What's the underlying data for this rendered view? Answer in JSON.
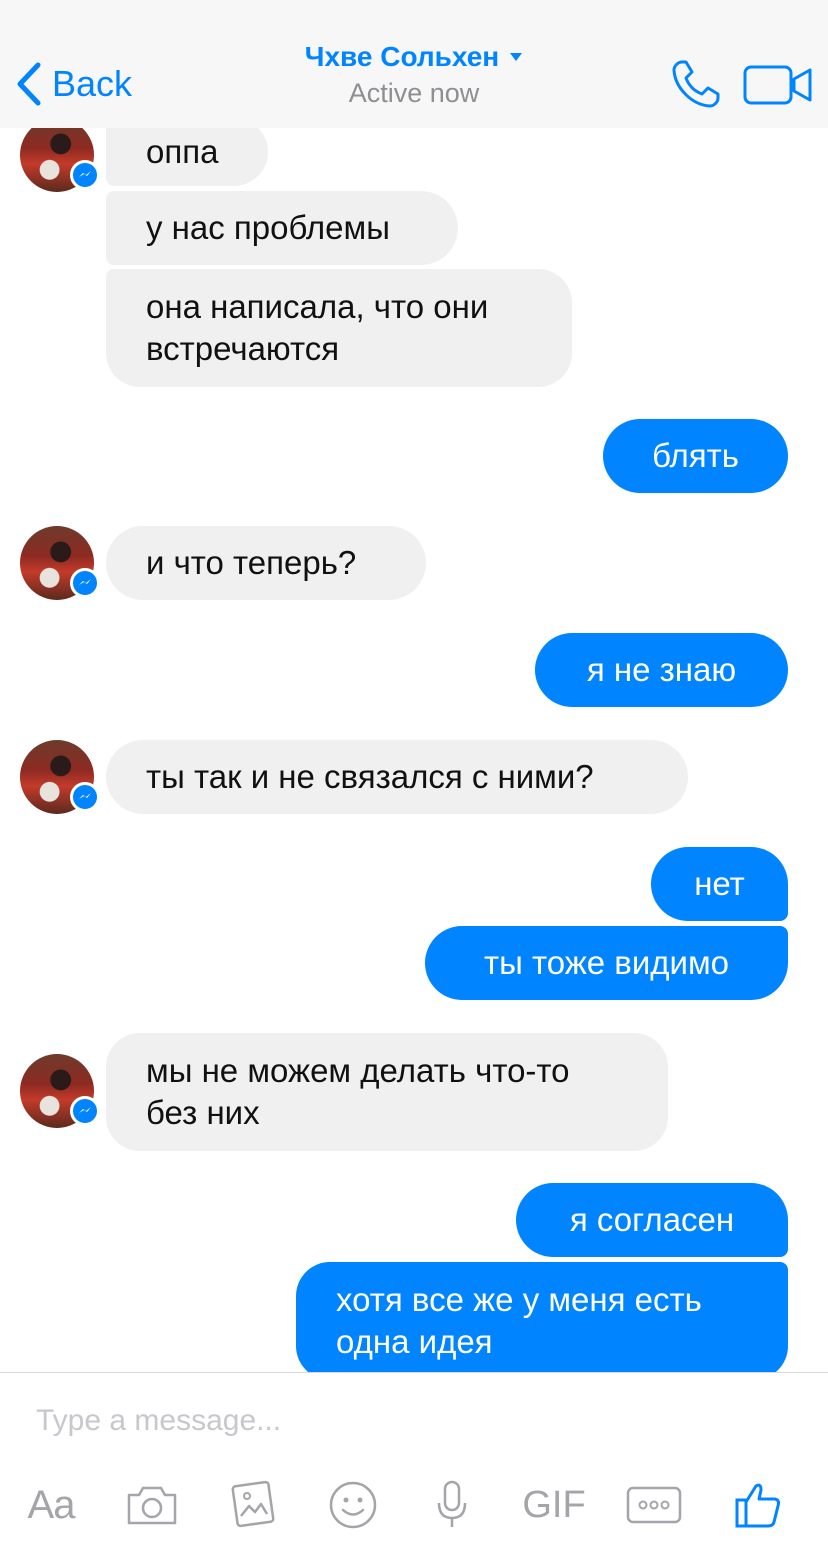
{
  "header": {
    "back_label": "Back",
    "contact_name": "Чхве Сольхен",
    "status": "Active now"
  },
  "messages": [
    {
      "direction": "incoming",
      "text": "оппа"
    },
    {
      "direction": "incoming",
      "text": "у нас проблемы"
    },
    {
      "direction": "incoming",
      "text": "она написала, что они\nвстречаются"
    },
    {
      "direction": "outgoing",
      "text": "блять"
    },
    {
      "direction": "incoming",
      "text": "и что теперь?"
    },
    {
      "direction": "outgoing",
      "text": "я не знаю"
    },
    {
      "direction": "incoming",
      "text": "ты так и не связался с ними?"
    },
    {
      "direction": "outgoing",
      "text": "нет"
    },
    {
      "direction": "outgoing",
      "text": "ты тоже видимо"
    },
    {
      "direction": "incoming",
      "text": "мы не можем делать что-то\nбез них"
    },
    {
      "direction": "outgoing",
      "text": "я согласен"
    },
    {
      "direction": "outgoing",
      "text": "хотя все же у меня есть\nодна идея"
    }
  ],
  "composer": {
    "placeholder": "Type a message...",
    "aa_label": "Aa",
    "gif_label": "GIF",
    "tools": [
      "text-format-icon",
      "camera-icon",
      "photo-icon",
      "emoji-icon",
      "microphone-icon",
      "gif-icon",
      "more-icon",
      "like-icon"
    ]
  },
  "colors": {
    "accent": "#0084ff",
    "incoming_bubble": "#f1f0f0",
    "header_bg": "#f7f7f7",
    "secondary_text": "#8e8e93",
    "toolbar_icon": "#a4a4a9"
  }
}
